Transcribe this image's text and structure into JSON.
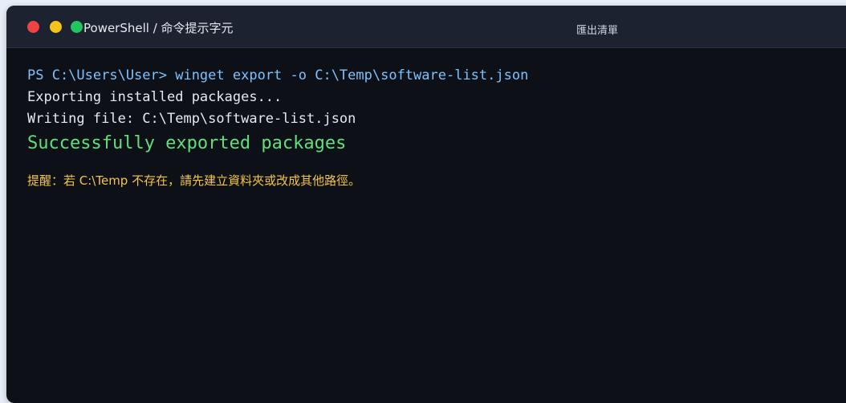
{
  "window": {
    "title": "PowerShell / 命令提示字元",
    "tab_label": "匯出清單"
  },
  "terminal": {
    "command": "PS C:\\Users\\User> winget export -o C:\\Temp\\software-list.json",
    "output_lines": [
      "Exporting installed packages...",
      "Writing file: C:\\Temp\\software-list.json"
    ],
    "success": "Successfully exported packages",
    "note": "提醒：若 C:\\Temp 不存在，請先建立資料夾或改成其他路徑。"
  },
  "colors": {
    "background": "#0d1117",
    "titlebar": "#1c2230",
    "command": "#7cc2ff",
    "output": "#e6e9ef",
    "success": "#5ee07a",
    "note": "#f5c542",
    "close": "#ef4444",
    "minimize": "#f6c21c",
    "maximize": "#22c55e"
  }
}
